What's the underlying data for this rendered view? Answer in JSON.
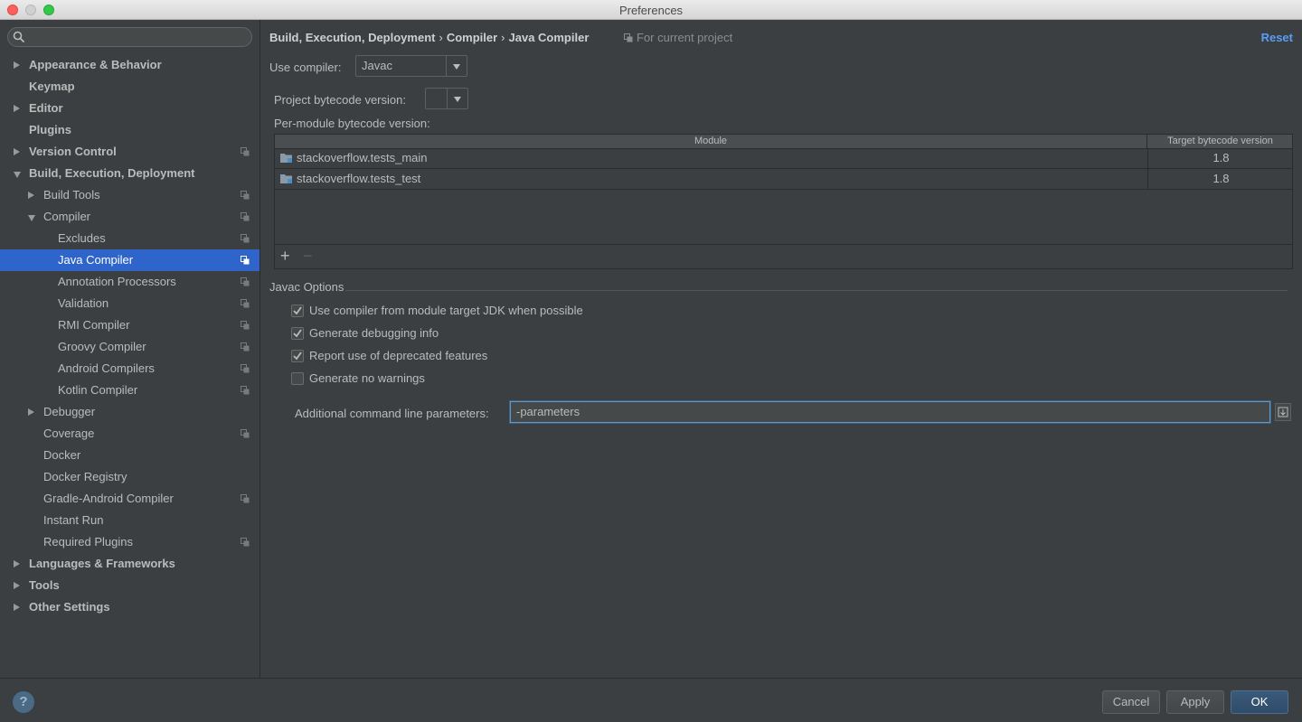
{
  "window": {
    "title": "Preferences"
  },
  "sidebar": {
    "search_placeholder": "",
    "items": [
      {
        "label": "Appearance & Behavior",
        "level": 0,
        "expander": "collapsed",
        "bold": true,
        "project": false,
        "selected": false
      },
      {
        "label": "Keymap",
        "level": 0,
        "expander": "none",
        "bold": true,
        "project": false,
        "selected": false
      },
      {
        "label": "Editor",
        "level": 0,
        "expander": "collapsed",
        "bold": true,
        "project": false,
        "selected": false
      },
      {
        "label": "Plugins",
        "level": 0,
        "expander": "none",
        "bold": true,
        "project": false,
        "selected": false
      },
      {
        "label": "Version Control",
        "level": 0,
        "expander": "collapsed",
        "bold": true,
        "project": true,
        "selected": false
      },
      {
        "label": "Build, Execution, Deployment",
        "level": 0,
        "expander": "expanded",
        "bold": true,
        "project": false,
        "selected": false
      },
      {
        "label": "Build Tools",
        "level": 1,
        "expander": "collapsed",
        "bold": false,
        "project": true,
        "selected": false
      },
      {
        "label": "Compiler",
        "level": 1,
        "expander": "expanded",
        "bold": false,
        "project": true,
        "selected": false
      },
      {
        "label": "Excludes",
        "level": 2,
        "expander": "none",
        "bold": false,
        "project": true,
        "selected": false
      },
      {
        "label": "Java Compiler",
        "level": 2,
        "expander": "none",
        "bold": false,
        "project": true,
        "selected": true
      },
      {
        "label": "Annotation Processors",
        "level": 2,
        "expander": "none",
        "bold": false,
        "project": true,
        "selected": false
      },
      {
        "label": "Validation",
        "level": 2,
        "expander": "none",
        "bold": false,
        "project": true,
        "selected": false
      },
      {
        "label": "RMI Compiler",
        "level": 2,
        "expander": "none",
        "bold": false,
        "project": true,
        "selected": false
      },
      {
        "label": "Groovy Compiler",
        "level": 2,
        "expander": "none",
        "bold": false,
        "project": true,
        "selected": false
      },
      {
        "label": "Android Compilers",
        "level": 2,
        "expander": "none",
        "bold": false,
        "project": true,
        "selected": false
      },
      {
        "label": "Kotlin Compiler",
        "level": 2,
        "expander": "none",
        "bold": false,
        "project": true,
        "selected": false
      },
      {
        "label": "Debugger",
        "level": 1,
        "expander": "collapsed",
        "bold": false,
        "project": false,
        "selected": false
      },
      {
        "label": "Coverage",
        "level": 1,
        "expander": "none",
        "bold": false,
        "project": true,
        "selected": false
      },
      {
        "label": "Docker",
        "level": 1,
        "expander": "none",
        "bold": false,
        "project": false,
        "selected": false
      },
      {
        "label": "Docker Registry",
        "level": 1,
        "expander": "none",
        "bold": false,
        "project": false,
        "selected": false
      },
      {
        "label": "Gradle-Android Compiler",
        "level": 1,
        "expander": "none",
        "bold": false,
        "project": true,
        "selected": false
      },
      {
        "label": "Instant Run",
        "level": 1,
        "expander": "none",
        "bold": false,
        "project": false,
        "selected": false
      },
      {
        "label": "Required Plugins",
        "level": 1,
        "expander": "none",
        "bold": false,
        "project": true,
        "selected": false
      },
      {
        "label": "Languages & Frameworks",
        "level": 0,
        "expander": "collapsed",
        "bold": true,
        "project": false,
        "selected": false
      },
      {
        "label": "Tools",
        "level": 0,
        "expander": "collapsed",
        "bold": true,
        "project": false,
        "selected": false
      },
      {
        "label": "Other Settings",
        "level": 0,
        "expander": "collapsed",
        "bold": true,
        "project": false,
        "selected": false
      }
    ]
  },
  "header": {
    "breadcrumb": [
      "Build, Execution, Deployment",
      "Compiler",
      "Java Compiler"
    ],
    "separator": "›",
    "scope": "For current project",
    "reset_label": "Reset"
  },
  "compiler": {
    "use_compiler_label": "Use compiler:",
    "use_compiler_value": "Javac",
    "bytecode_label": "Project bytecode version:",
    "bytecode_value": "",
    "per_module_label": "Per-module bytecode version:"
  },
  "table": {
    "columns": [
      "Module",
      "Target bytecode version"
    ],
    "rows": [
      {
        "module": "stackoverflow.tests_main",
        "version": "1.8"
      },
      {
        "module": "stackoverflow.tests_test",
        "version": "1.8"
      }
    ],
    "add_label": "+",
    "remove_label": "−"
  },
  "javac": {
    "group_title": "Javac Options",
    "options": [
      {
        "label": "Use compiler from module target JDK when possible",
        "checked": true
      },
      {
        "label": "Generate debugging info",
        "checked": true
      },
      {
        "label": "Report use of deprecated features",
        "checked": true
      },
      {
        "label": "Generate no warnings",
        "checked": false
      }
    ],
    "params_label": "Additional command line parameters:",
    "params_value": "-parameters"
  },
  "footer": {
    "help_label": "?",
    "cancel_label": "Cancel",
    "apply_label": "Apply",
    "ok_label": "OK"
  },
  "colors": {
    "background": "#3c3f41",
    "selection": "#2f65ca",
    "link": "#589df6",
    "text": "#bbbbbb"
  }
}
